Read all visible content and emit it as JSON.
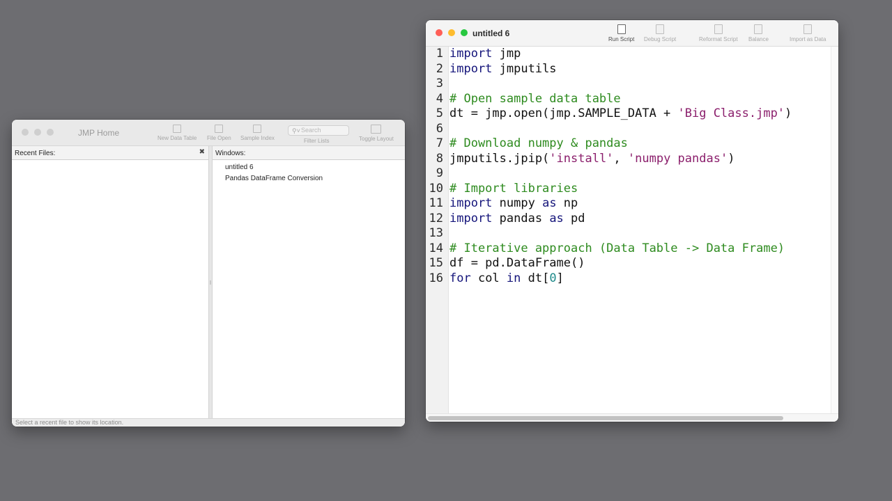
{
  "jmp_home": {
    "title": "JMP Home",
    "toolbar": [
      {
        "label": "New Data Table",
        "icon": "new-data-table-icon"
      },
      {
        "label": "File Open",
        "icon": "file-open-icon"
      },
      {
        "label": "Sample Index",
        "icon": "sample-index-icon"
      }
    ],
    "search": {
      "placeholder": "Search",
      "label": "Filter Lists"
    },
    "toggle_layout": {
      "label": "Toggle Layout",
      "icon": "toggle-layout-icon"
    },
    "recent_files": {
      "header": "Recent Files:"
    },
    "windows": {
      "header": "Windows:",
      "items": [
        "untitled 6",
        "Pandas DataFrame Conversion"
      ]
    },
    "status": "Select a recent file to show its location."
  },
  "script_editor": {
    "title": "untitled 6",
    "toolbar": [
      {
        "label": "Run Script",
        "icon": "run-script-icon",
        "enabled": true
      },
      {
        "label": "Debug Script",
        "icon": "debug-script-icon",
        "enabled": false
      },
      {
        "label": "Reformat Script",
        "icon": "reformat-script-icon",
        "enabled": false
      },
      {
        "label": "Balance",
        "icon": "balance-icon",
        "enabled": false
      },
      {
        "label": "Import as Data",
        "icon": "import-as-data-icon",
        "enabled": false
      }
    ],
    "lines": [
      {
        "n": "1",
        "tokens": [
          [
            "kw",
            "import"
          ],
          [
            "",
            " jmp"
          ]
        ]
      },
      {
        "n": "2",
        "tokens": [
          [
            "kw",
            "import"
          ],
          [
            "",
            " jmputils"
          ]
        ]
      },
      {
        "n": "3",
        "tokens": []
      },
      {
        "n": "4",
        "tokens": [
          [
            "cm",
            "# Open sample data table"
          ]
        ]
      },
      {
        "n": "5",
        "tokens": [
          [
            "",
            "dt = jmp.open(jmp.SAMPLE_DATA + "
          ],
          [
            "st",
            "'Big Class.jmp'"
          ],
          [
            "",
            ")"
          ]
        ]
      },
      {
        "n": "6",
        "tokens": []
      },
      {
        "n": "7",
        "tokens": [
          [
            "cm",
            "# Download numpy & pandas"
          ]
        ]
      },
      {
        "n": "8",
        "tokens": [
          [
            "",
            "jmputils.jpip("
          ],
          [
            "st",
            "'install'"
          ],
          [
            "",
            ", "
          ],
          [
            "st",
            "'numpy pandas'"
          ],
          [
            "",
            ")"
          ]
        ]
      },
      {
        "n": "9",
        "tokens": []
      },
      {
        "n": "10",
        "tokens": [
          [
            "cm",
            "# Import libraries"
          ]
        ]
      },
      {
        "n": "11",
        "tokens": [
          [
            "kw",
            "import"
          ],
          [
            "",
            " numpy "
          ],
          [
            "kw",
            "as"
          ],
          [
            "",
            " np"
          ]
        ]
      },
      {
        "n": "12",
        "tokens": [
          [
            "kw",
            "import"
          ],
          [
            "",
            " pandas "
          ],
          [
            "kw",
            "as"
          ],
          [
            "",
            " pd"
          ]
        ]
      },
      {
        "n": "13",
        "tokens": []
      },
      {
        "n": "14",
        "tokens": [
          [
            "cm",
            "# Iterative approach (Data Table -> Data Frame)"
          ]
        ]
      },
      {
        "n": "15",
        "tokens": [
          [
            "",
            "df = pd.DataFrame()"
          ]
        ]
      },
      {
        "n": "16",
        "tokens": [
          [
            "kw",
            "for"
          ],
          [
            "",
            " col "
          ],
          [
            "kw",
            "in"
          ],
          [
            "",
            " dt["
          ],
          [
            "nm",
            "0"
          ],
          [
            "",
            "]"
          ]
        ]
      }
    ]
  },
  "colors": {
    "desktop": "#6d6d71",
    "close": "#ff5f57",
    "minimize": "#febc2e",
    "zoom": "#28c840",
    "keyword": "#14147a",
    "comment": "#2e8b1f",
    "string": "#8b1f6c",
    "number": "#1e8a8a"
  }
}
